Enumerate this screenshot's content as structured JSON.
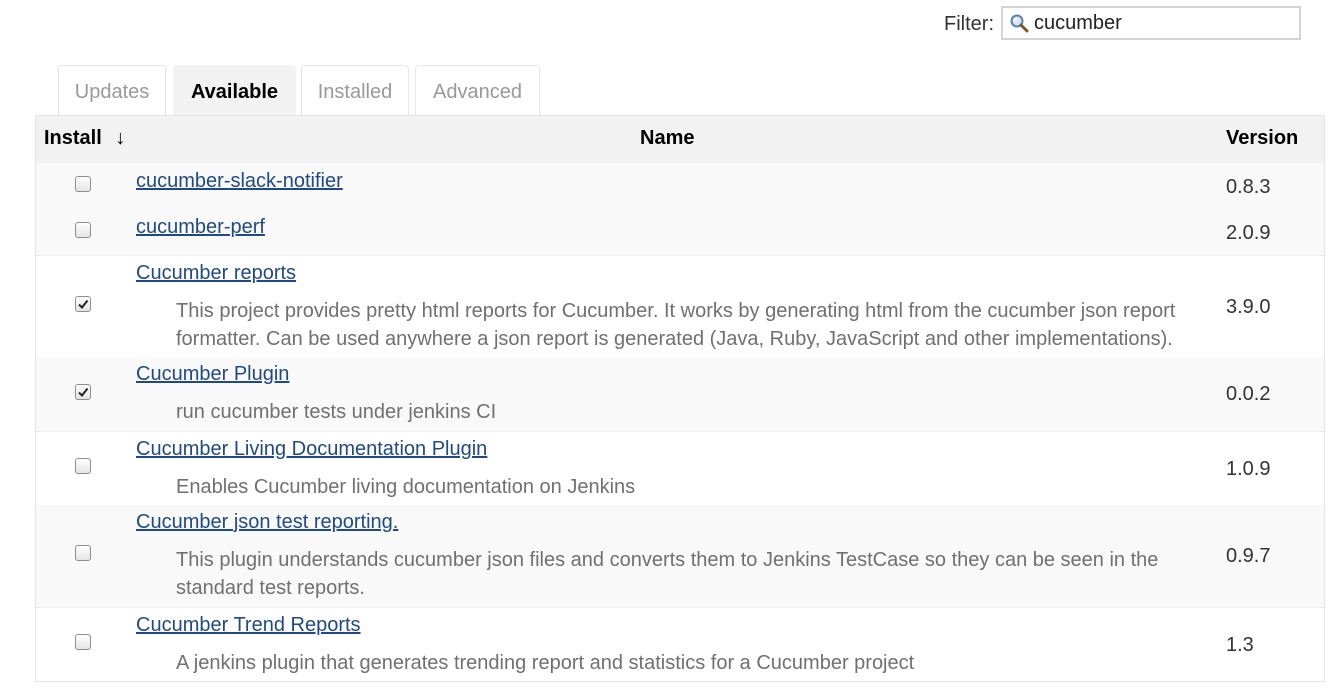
{
  "filter": {
    "label": "Filter:",
    "value": "cucumber",
    "icon": "search-icon"
  },
  "tabs": [
    {
      "label": "Updates",
      "active": false
    },
    {
      "label": "Available",
      "active": true
    },
    {
      "label": "Installed",
      "active": false
    },
    {
      "label": "Advanced",
      "active": false
    }
  ],
  "table": {
    "headers": {
      "install": "Install",
      "sort_indicator": "↓",
      "name": "Name",
      "version": "Version"
    },
    "rows": [
      {
        "name": "cucumber-slack-notifier",
        "description": "",
        "version": "0.8.3",
        "checked": false
      },
      {
        "name": "cucumber-perf",
        "description": "",
        "version": "2.0.9",
        "checked": false
      },
      {
        "name": "Cucumber reports",
        "description": "This project provides pretty html reports for Cucumber. It works by generating html from the cucumber json report formatter. Can be used anywhere a json report is generated (Java, Ruby, JavaScript and other implementations).",
        "version": "3.9.0",
        "checked": true
      },
      {
        "name": "Cucumber Plugin",
        "description": "run cucumber tests under jenkins CI",
        "version": "0.0.2",
        "checked": true
      },
      {
        "name": "Cucumber Living Documentation Plugin",
        "description": "Enables Cucumber living documentation on Jenkins",
        "version": "1.0.9",
        "checked": false
      },
      {
        "name": "Cucumber json test reporting.",
        "description": "This plugin understands cucumber json files and converts them to Jenkins TestCase so they can be seen in the standard test reports.",
        "version": "0.9.7",
        "checked": false
      },
      {
        "name": "Cucumber Trend Reports",
        "description": "A jenkins plugin that generates trending report and statistics for a Cucumber project",
        "version": "1.3",
        "checked": false
      }
    ]
  }
}
